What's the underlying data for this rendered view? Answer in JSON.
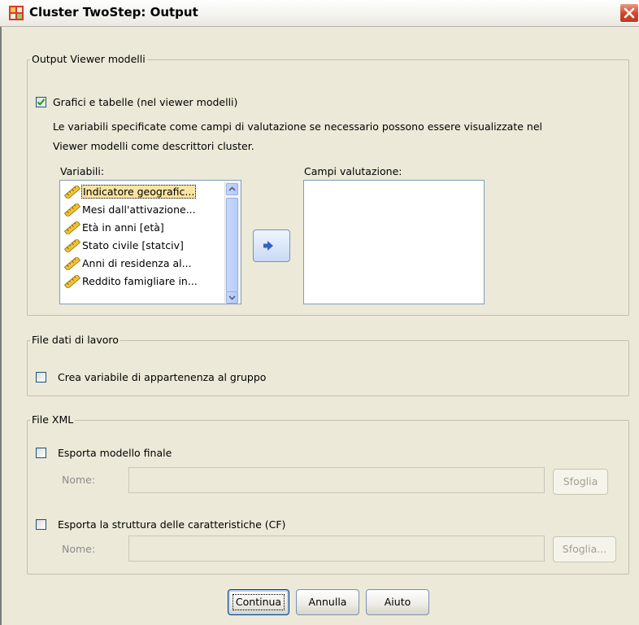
{
  "window": {
    "title": "Cluster TwoStep: Output"
  },
  "output_viewer": {
    "legend": "Output Viewer modelli",
    "charts_checkbox": {
      "label": "Grafici e tabelle (nel viewer modelli)",
      "checked": true
    },
    "description_line1": "Le variabili specificate come campi di valutazione se necessario possono essere visualizzate nel",
    "description_line2": "Viewer modelli come descrittori cluster.",
    "variables_label": "Variabili:",
    "variables": [
      "Indicatore geografic...",
      "Mesi dall'attivazione...",
      "Età in anni [età]",
      "Stato civile [statciv]",
      "Anni di residenza al...",
      "Reddito famigliare in..."
    ],
    "variable_icon": "scale-ruler-icon",
    "move_button_icon": "right-arrow-icon",
    "eval_fields_label": "Campi valutazione:"
  },
  "working_file": {
    "legend": "File dati di lavoro",
    "create_var_checkbox": {
      "label": "Crea variabile di appartenenza al gruppo",
      "checked": false
    }
  },
  "xml_file": {
    "legend": "File XML",
    "export_model_checkbox": {
      "label": "Esporta modello finale",
      "checked": false
    },
    "export_model_name_label": "Nome:",
    "export_model_browse": "Sfoglia",
    "export_cf_checkbox": {
      "label": "Esporta la struttura delle caratteristiche (CF)",
      "checked": false
    },
    "export_cf_name_label": "Nome:",
    "export_cf_browse": "Sfoglia..."
  },
  "buttons": {
    "continue": "Continua",
    "cancel": "Annulla",
    "help": "Aiuto"
  },
  "colors": {
    "dialog_bg": "#ece9d8",
    "close_red": "#d1442a",
    "selection": "#fbe4a2"
  }
}
